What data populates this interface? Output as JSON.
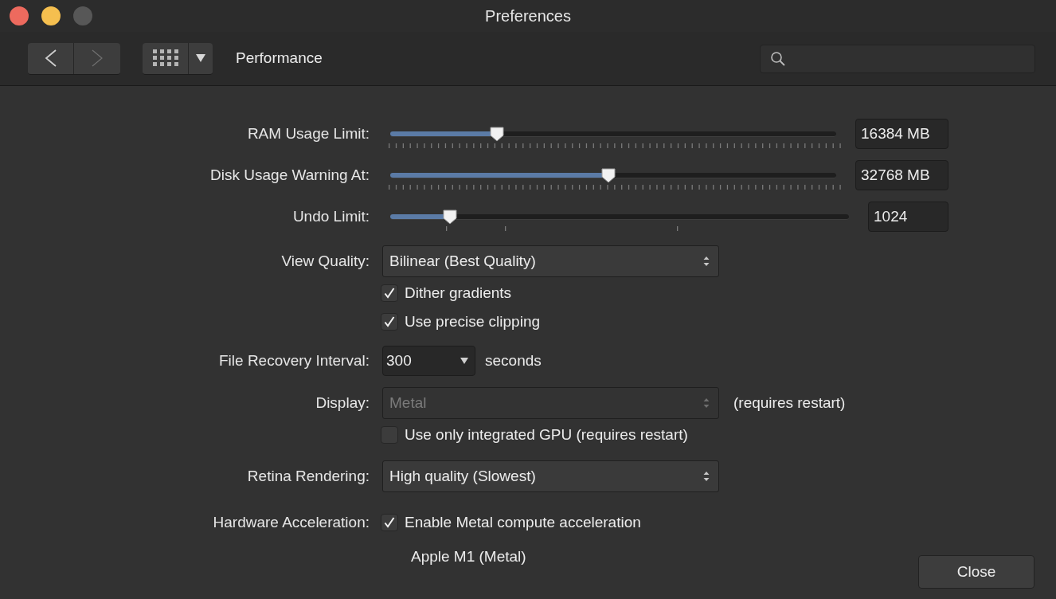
{
  "window": {
    "title": "Preferences",
    "controls": [
      {
        "color": "#ed6a5e"
      },
      {
        "color": "#f5bf4f"
      },
      {
        "color": "#575757"
      }
    ]
  },
  "toolbar": {
    "back_enabled": true,
    "forward_enabled": false,
    "page_title": "Performance"
  },
  "settings": [
    {
      "kind": "slider",
      "label": "RAM Usage Limit:",
      "level": 0.24,
      "value": "16384 MB",
      "dense_ticks": true
    },
    {
      "kind": "slider",
      "label": "Disk Usage Warning At:",
      "level": 0.49,
      "value": "32768 MB",
      "dense_ticks": true
    },
    {
      "kind": "slider",
      "label": "Undo Limit:",
      "level": 0.13,
      "value": "1024",
      "dense_ticks": false
    },
    {
      "kind": "select",
      "label": "View Quality:",
      "value": "Bilinear (Best Quality)",
      "disabled": false
    },
    {
      "kind": "checkbox",
      "text": "Dither gradients",
      "checked": true
    },
    {
      "kind": "checkbox",
      "text": "Use precise clipping",
      "checked": true
    },
    {
      "kind": "combo",
      "label": "File Recovery Interval:",
      "value": "300",
      "suffix": "seconds"
    },
    {
      "kind": "select",
      "label": "Display:",
      "value": "Metal",
      "disabled": true,
      "note": "(requires restart)"
    },
    {
      "kind": "checkbox",
      "text": "Use only integrated GPU (requires restart)",
      "checked": false
    },
    {
      "kind": "select",
      "label": "Retina Rendering:",
      "value": "High quality (Slowest)",
      "disabled": false
    },
    {
      "kind": "checkbox",
      "label": "Hardware Acceleration:",
      "text": "Enable Metal compute acceleration",
      "checked": true
    },
    {
      "kind": "note",
      "text": "Apple M1 (Metal)"
    }
  ],
  "buttons": [
    "Close"
  ]
}
